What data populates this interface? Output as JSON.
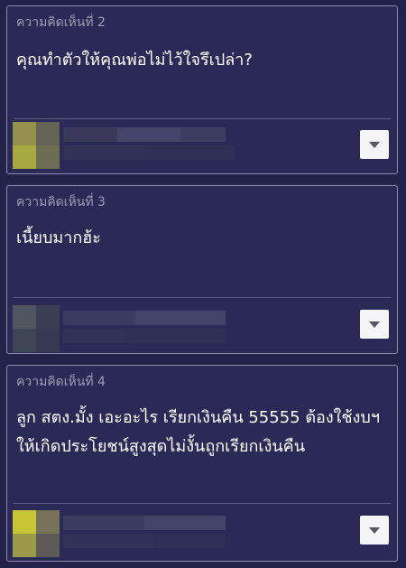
{
  "comments": [
    {
      "label": "ความคิดเห็นที่ 2",
      "text": "คุณทำตัวให้คุณพ่อไม่ไว้ใจรึเปล่า?",
      "avatar_colors": [
        "#b7b34a",
        "#8a8a55",
        "#a8a842",
        "#6d6d52"
      ]
    },
    {
      "label": "ความคิดเห็นที่ 3",
      "text": "เนี้ยบมากฮ้ะ",
      "avatar_colors": [
        "#4f5660",
        "#3a3f55",
        "#3e4656",
        "#353a52"
      ]
    },
    {
      "label": "ความคิดเห็นที่ 4",
      "text": "ลูก สตง.มั้ง เอะอะไร เรียกเงินคืน 55555 ต้องใช้งบฯให้เกิดประโยชน์สูงสุดไม่งั้นถูกเรียกเงินคืน",
      "avatar_colors": [
        "#c7c435",
        "#77725a",
        "#9b9a48",
        "#5d5a58"
      ]
    }
  ],
  "icons": {
    "menu": "chevron-down-icon"
  }
}
